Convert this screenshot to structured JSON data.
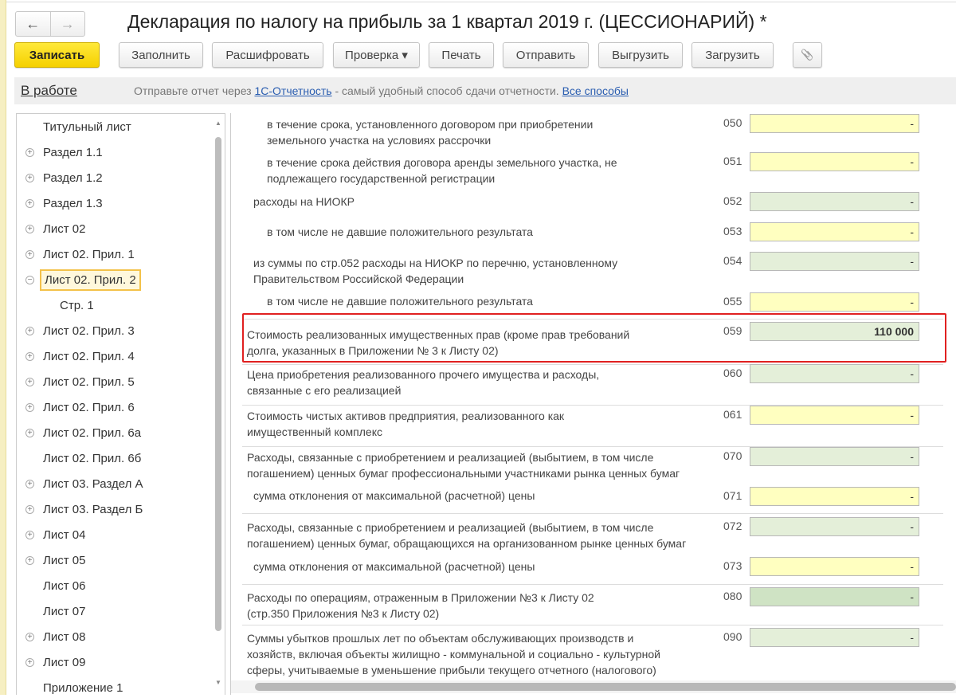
{
  "header": {
    "title": "Декларация по налогу на прибыль за 1 квартал 2019 г. (ЦЕССИОНАРИЙ) *",
    "back": "←",
    "forward": "→"
  },
  "toolbar": {
    "save": "Записать",
    "fill": "Заполнить",
    "decode": "Расшифровать",
    "check": "Проверка ▾",
    "print": "Печать",
    "send": "Отправить",
    "export": "Выгрузить",
    "import": "Загрузить",
    "attach": "📎"
  },
  "infobar": {
    "status": "В работе",
    "text1": "Отправьте отчет через ",
    "link1": "1С-Отчетность",
    "text2": " - самый удобный способ сдачи отчетности. ",
    "link2": "Все способы"
  },
  "tree": [
    {
      "label": "Титульный лист",
      "exp": ""
    },
    {
      "label": "Раздел 1.1",
      "exp": "+"
    },
    {
      "label": "Раздел 1.2",
      "exp": "+"
    },
    {
      "label": "Раздел 1.3",
      "exp": "+"
    },
    {
      "label": "Лист 02",
      "exp": "+"
    },
    {
      "label": "Лист 02. Прил. 1",
      "exp": "+"
    },
    {
      "label": "Лист 02. Прил. 2",
      "exp": "−",
      "selected": true
    },
    {
      "label": "Стр. 1",
      "exp": "",
      "child": true
    },
    {
      "label": "Лист 02. Прил. 3",
      "exp": "+"
    },
    {
      "label": "Лист 02. Прил. 4",
      "exp": "+"
    },
    {
      "label": "Лист 02. Прил. 5",
      "exp": "+"
    },
    {
      "label": "Лист 02. Прил. 6",
      "exp": "+"
    },
    {
      "label": "Лист 02. Прил. 6а",
      "exp": "+"
    },
    {
      "label": "Лист 02. Прил. 6б",
      "exp": ""
    },
    {
      "label": "Лист 03. Раздел А",
      "exp": "+"
    },
    {
      "label": "Лист 03. Раздел Б",
      "exp": "+"
    },
    {
      "label": "Лист 04",
      "exp": "+"
    },
    {
      "label": "Лист 05",
      "exp": "+"
    },
    {
      "label": "Лист 06",
      "exp": ""
    },
    {
      "label": "Лист 07",
      "exp": ""
    },
    {
      "label": "Лист 08",
      "exp": "+"
    },
    {
      "label": "Лист 09",
      "exp": "+"
    },
    {
      "label": "Приложение 1",
      "exp": ""
    }
  ],
  "rows": [
    {
      "code": "050",
      "label": "в течение срока, установленного договором при приобретении\nземельного участка на условиях рассрочки",
      "value": "-",
      "color": "y",
      "indent": 2
    },
    {
      "code": "051",
      "label": "в течение срока действия договора аренды земельного участка, не\nподлежащего государственной регистрации",
      "value": "-",
      "color": "y",
      "indent": 2
    },
    {
      "code": "052",
      "label": "расходы на НИОКР",
      "value": "-",
      "color": "g",
      "indent": 1
    },
    {
      "code": "053",
      "label": "в том числе не давшие положительного результата",
      "value": "-",
      "color": "y",
      "indent": 2
    },
    {
      "code": "054",
      "label": "из суммы по стр.052 расходы на НИОКР по перечню, установленному\nПравительством Российской Федерации",
      "value": "-",
      "color": "g",
      "indent": 1
    },
    {
      "code": "055",
      "label": "в том числе не давшие положительного результата",
      "value": "-",
      "color": "y",
      "indent": 2
    },
    {
      "code": "059",
      "label": "Стоимость реализованных имущественных прав (кроме прав требований\nдолга, указанных в Приложении № 3 к Листу 02)",
      "value": "110 000",
      "color": "g",
      "indent": 0,
      "bold": true
    },
    {
      "code": "060",
      "label": "Цена приобретения реализованного прочего имущества и расходы,\nсвязанные с его реализацией",
      "value": "-",
      "color": "g",
      "indent": 0
    },
    {
      "code": "061",
      "label": "Стоимость чистых активов предприятия, реализованного как\nимущественный комплекс",
      "value": "-",
      "color": "y",
      "indent": 0
    },
    {
      "code": "070",
      "label": "Расходы, связанные с приобретением и реализацией (выбытием, в том числе\nпогашением) ценных бумаг профессиональными участниками рынка ценных бумаг",
      "value": "-",
      "color": "g",
      "indent": 0
    },
    {
      "code": "071",
      "label": "сумма отклонения от максимальной (расчетной) цены",
      "value": "-",
      "color": "y",
      "indent": 1
    },
    {
      "code": "072",
      "label": "Расходы, связанные с приобретением и реализацией (выбытием, в том числе\nпогашением) ценных бумаг, обращающихся на организованном рынке ценных бумаг",
      "value": "-",
      "color": "g",
      "indent": 0
    },
    {
      "code": "073",
      "label": "сумма отклонения от максимальной (расчетной) цены",
      "value": "-",
      "color": "y",
      "indent": 1
    },
    {
      "code": "080",
      "label": "Расходы по операциям, отраженным в Приложении №3 к Листу 02\n(стр.350 Приложения №3 к Листу 02)",
      "value": "-",
      "color": "dg",
      "indent": 0
    },
    {
      "code": "090",
      "label": "Суммы убытков прошлых лет по объектам обслуживающих производств и\nхозяйств, включая объекты жилищно - коммунальной и социально - культурной\nсферы, учитываемые в уменьшение прибыли текущего отчетного (налогового)\nпериода, полученной по указанным видам деятельности",
      "value": "-",
      "color": "g",
      "indent": 0
    }
  ]
}
